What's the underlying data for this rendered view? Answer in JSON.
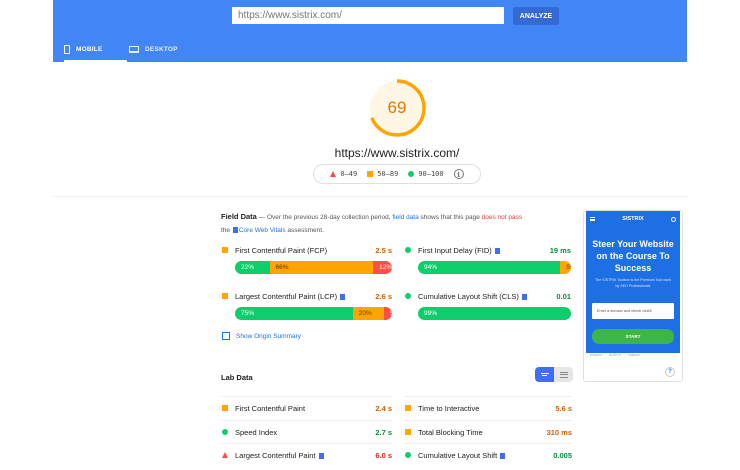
{
  "header": {
    "url_placeholder": "https://www.sistrix.com/",
    "analyze_label": "ANALYZE",
    "tabs": [
      {
        "label": "MOBILE",
        "active": true,
        "icon": "phone-icon"
      },
      {
        "label": "DESKTOP",
        "active": false,
        "icon": "desktop-icon"
      }
    ]
  },
  "score": {
    "value": "69",
    "fraction": 0.69,
    "color": "#ffa400",
    "url": "https://www.sistrix.com/"
  },
  "legend": {
    "poor": "0–49",
    "average": "50–89",
    "good": "90–100"
  },
  "field_data": {
    "title": "Field Data",
    "desc_1": "— Over the previous 28-day collection period,",
    "desc_link": "field data",
    "desc_2": "shows that this page",
    "desc_fail": "does not pass",
    "desc_3": "the",
    "desc_cwv": "Core Web Vitals",
    "desc_4": "assessment.",
    "metrics": [
      {
        "name": "First Contentful Paint (FCP)",
        "value": "2.5 s",
        "status": "orange",
        "dist": [
          22,
          66,
          12
        ],
        "labels": [
          "22%",
          "66%",
          "12%"
        ]
      },
      {
        "name": "First Input Delay (FID)",
        "value": "19 ms",
        "status": "green",
        "dist": [
          94,
          5,
          2
        ],
        "labels": [
          "94%",
          "5%",
          "2%"
        ]
      },
      {
        "name": "Largest Contentful Paint (LCP)",
        "value": "2.6 s",
        "status": "orange",
        "dist": [
          75,
          20,
          5
        ],
        "labels": [
          "75%",
          "20%",
          "5%"
        ]
      },
      {
        "name": "Cumulative Layout Shift (CLS)",
        "value": "0.01",
        "status": "green",
        "dist": [
          99,
          0,
          0
        ],
        "labels": [
          "99%",
          "",
          ""
        ]
      }
    ],
    "origin_label": "Show Origin Summary"
  },
  "lab_data": {
    "title": "Lab Data",
    "metrics": [
      {
        "name": "First Contentful Paint",
        "value": "2.4 s",
        "status": "orange"
      },
      {
        "name": "Time to Interactive",
        "value": "5.6 s",
        "status": "orange"
      },
      {
        "name": "Speed Index",
        "value": "2.7 s",
        "status": "green"
      },
      {
        "name": "Total Blocking Time",
        "value": "310 ms",
        "status": "orange"
      },
      {
        "name": "Largest Contentful Paint",
        "value": "6.0 s",
        "status": "red"
      },
      {
        "name": "Cumulative Layout Shift",
        "value": "0.005",
        "status": "green"
      }
    ]
  },
  "screenshot": {
    "brand": "SISTRIX",
    "headline": "Steer Your Website on the Course To Success",
    "sub": "The SISTRIX Toolbox is the Premium Tool used by SEO Professionals",
    "input_placeholder": "Enter a domain and check visibil",
    "start_label": "START",
    "brands": [
      "amazon",
      "BOSCH",
      "zalando"
    ],
    "help": "?"
  }
}
